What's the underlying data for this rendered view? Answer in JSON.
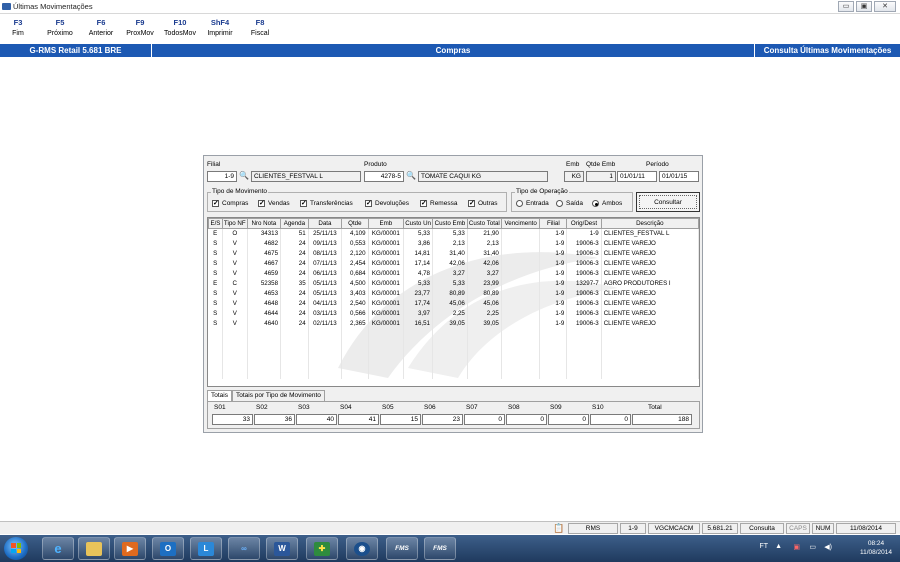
{
  "window": {
    "title": "Últimas Movimentações",
    "controls": [
      "▭",
      "▣",
      "✕"
    ]
  },
  "fkeys": [
    {
      "key": "F3",
      "label": "Fim"
    },
    {
      "key": "F5",
      "label": "Próximo"
    },
    {
      "key": "F6",
      "label": "Anterior"
    },
    {
      "key": "F9",
      "label": "ProxMov"
    },
    {
      "key": "F10",
      "label": "TodosMov"
    },
    {
      "key": "ShF4",
      "label": "Imprimir"
    },
    {
      "key": "F8",
      "label": "Fiscal"
    }
  ],
  "header": {
    "left": "G-RMS Retail 5.681 BRE",
    "center": "Compras",
    "right": "Consulta Últimas Movimentações"
  },
  "form": {
    "filial_label": "Filial",
    "filial_code": "1-9",
    "filial_name": "CLIENTES_FESTVAL L",
    "produto_label": "Produto",
    "produto_code": "4278-5",
    "produto_name": "TOMATE CAQUI KG",
    "emb_label": "Emb",
    "emb_value": "KG",
    "qtde_emb_label": "Qtde Emb",
    "qtde_emb_value": "1",
    "periodo_label": "Período",
    "periodo_inicio": "01/01/11",
    "periodo_fim": "01/01/15"
  },
  "tipo_movimento": {
    "title": "Tipo de Movimento",
    "options": [
      {
        "label": "Compras",
        "checked": true
      },
      {
        "label": "Vendas",
        "checked": true
      },
      {
        "label": "Transferências",
        "checked": true
      },
      {
        "label": "Devoluções",
        "checked": true
      },
      {
        "label": "Remessa",
        "checked": true
      },
      {
        "label": "Outras",
        "checked": true
      }
    ]
  },
  "tipo_operacao": {
    "title": "Tipo de Operação",
    "options": [
      {
        "label": "Entrada",
        "selected": false
      },
      {
        "label": "Saída",
        "selected": false
      },
      {
        "label": "Ambos",
        "selected": true
      }
    ]
  },
  "consultar_label": "Consultar",
  "grid": {
    "columns": [
      "E/S",
      "Tipo NF",
      "Nro Nota",
      "Agenda",
      "Data",
      "Qtde",
      "Emb",
      "Custo Un",
      "Custo Emb",
      "Custo Total",
      "Vencimento",
      "Filial",
      "Orig/Dest",
      "Descrição"
    ],
    "rows": [
      [
        "E",
        "O",
        "34313",
        "51",
        "25/11/13",
        "4,109",
        "KG/00001",
        "5,33",
        "5,33",
        "21,90",
        "",
        "1-9",
        "1-9",
        "CLIENTES_FESTVAL L"
      ],
      [
        "S",
        "V",
        "4682",
        "24",
        "09/11/13",
        "0,553",
        "KG/00001",
        "3,86",
        "2,13",
        "2,13",
        "",
        "1-9",
        "19006-3",
        "CLIENTE VAREJO"
      ],
      [
        "S",
        "V",
        "4675",
        "24",
        "08/11/13",
        "2,120",
        "KG/00001",
        "14,81",
        "31,40",
        "31,40",
        "",
        "1-9",
        "19006-3",
        "CLIENTE VAREJO"
      ],
      [
        "S",
        "V",
        "4667",
        "24",
        "07/11/13",
        "2,454",
        "KG/00001",
        "17,14",
        "42,06",
        "42,06",
        "",
        "1-9",
        "19006-3",
        "CLIENTE VAREJO"
      ],
      [
        "S",
        "V",
        "4659",
        "24",
        "06/11/13",
        "0,684",
        "KG/00001",
        "4,78",
        "3,27",
        "3,27",
        "",
        "1-9",
        "19006-3",
        "CLIENTE VAREJO"
      ],
      [
        "E",
        "C",
        "52358",
        "35",
        "05/11/13",
        "4,500",
        "KG/00001",
        "5,33",
        "5,33",
        "23,99",
        "",
        "1-9",
        "13297-7",
        "AGRO PRODUTORES I"
      ],
      [
        "S",
        "V",
        "4653",
        "24",
        "05/11/13",
        "3,403",
        "KG/00001",
        "23,77",
        "80,89",
        "80,89",
        "",
        "1-9",
        "19006-3",
        "CLIENTE VAREJO"
      ],
      [
        "S",
        "V",
        "4648",
        "24",
        "04/11/13",
        "2,540",
        "KG/00001",
        "17,74",
        "45,06",
        "45,06",
        "",
        "1-9",
        "19006-3",
        "CLIENTE VAREJO"
      ],
      [
        "S",
        "V",
        "4644",
        "24",
        "03/11/13",
        "0,566",
        "KG/00001",
        "3,97",
        "2,25",
        "2,25",
        "",
        "1-9",
        "19006-3",
        "CLIENTE VAREJO"
      ],
      [
        "S",
        "V",
        "4640",
        "24",
        "02/11/13",
        "2,365",
        "KG/00001",
        "16,51",
        "39,05",
        "39,05",
        "",
        "1-9",
        "19006-3",
        "CLIENTE VAREJO"
      ]
    ]
  },
  "tabs": [
    "Totais",
    "Totais por Tipo de Movimento"
  ],
  "totals": [
    {
      "label": "S01",
      "value": "33"
    },
    {
      "label": "S02",
      "value": "36"
    },
    {
      "label": "S03",
      "value": "40"
    },
    {
      "label": "S04",
      "value": "41"
    },
    {
      "label": "S05",
      "value": "15"
    },
    {
      "label": "S06",
      "value": "23"
    },
    {
      "label": "S07",
      "value": "0"
    },
    {
      "label": "S08",
      "value": "0"
    },
    {
      "label": "S09",
      "value": "0"
    },
    {
      "label": "S10",
      "value": "0"
    },
    {
      "label": "Total",
      "value": "188"
    }
  ],
  "status": {
    "system": "RMS",
    "filial": "1-9",
    "user": "VGCMCACM",
    "version": "5.681.21",
    "mode": "Consulta",
    "caps": "CAPS",
    "num": "NUM",
    "date": "11/08/2014"
  },
  "taskbar": {
    "apps": [
      "ie-icon",
      "explorer-icon",
      "media-icon",
      "outlook-icon",
      "lync-icon",
      "app-icon",
      "word-icon",
      "health-icon",
      "remote-icon",
      "rms-icon",
      "rms-icon"
    ],
    "rms_label": "FMS",
    "tray_lang": "FT",
    "time": "08:24",
    "date": "11/08/2014"
  }
}
